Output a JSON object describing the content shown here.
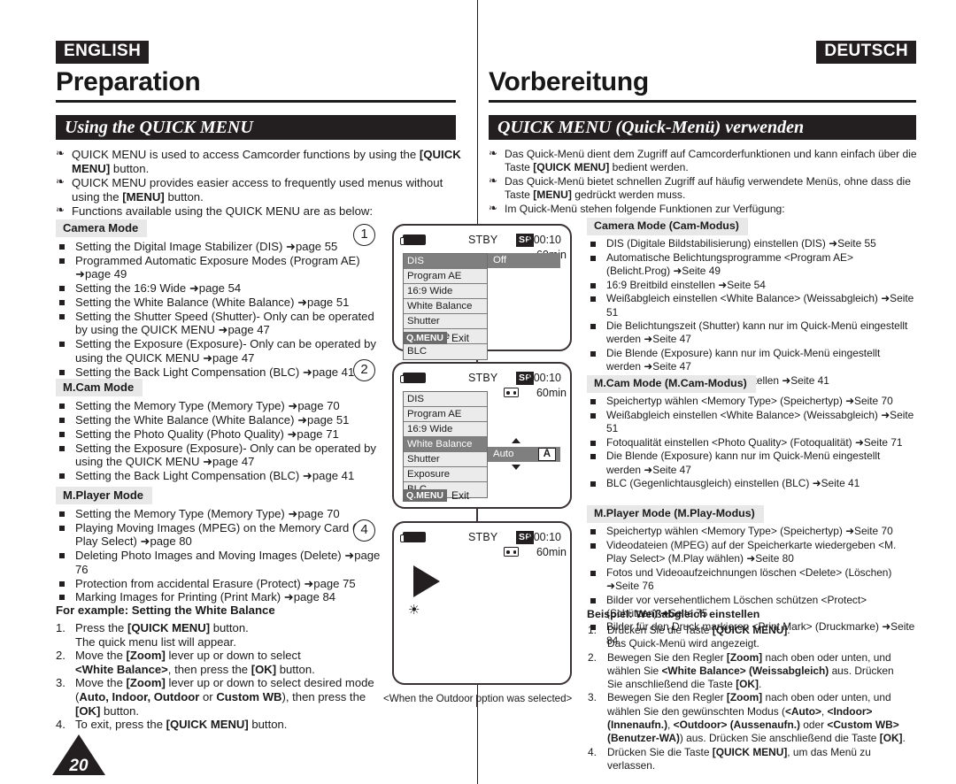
{
  "page_number": "20",
  "english": {
    "lang_tag": "ENGLISH",
    "chapter": "Preparation",
    "banner": "Using the QUICK MENU",
    "intro": [
      "QUICK MENU is used to access Camcorder functions by using the [QUICK MENU] button.",
      "QUICK MENU provides easier access to frequently used menus without using the [MENU] button.",
      "Functions available using the QUICK MENU are as below:"
    ],
    "sections": [
      {
        "heading": "Camera Mode",
        "items": [
          "Setting the Digital Image Stabilizer (DIS) ➜page 55",
          "Programmed Automatic Exposure Modes (Program AE) ➜page 49",
          "Setting the 16:9 Wide ➜page 54",
          "Setting the White Balance (White Balance) ➜page 51",
          "Setting the Shutter Speed (Shutter)- Only can be operated by using the QUICK MENU ➜page 47",
          "Setting the Exposure (Exposure)- Only can be operated by using the QUICK MENU ➜page 47",
          "Setting the Back Light Compensation (BLC) ➜page 41"
        ]
      },
      {
        "heading": "M.Cam Mode",
        "items": [
          "Setting the Memory Type (Memory Type) ➜page 70",
          "Setting the White Balance (White Balance) ➜page 51",
          "Setting the Photo Quality (Photo Quality) ➜page 71",
          "Setting the Exposure (Exposure)- Only can be operated by using the QUICK MENU ➜page 47",
          "Setting the Back Light Compensation (BLC) ➜page 41"
        ]
      },
      {
        "heading": "M.Player Mode",
        "items": [
          "Setting the Memory Type (Memory Type) ➜page 70",
          "Playing Moving Images (MPEG) on the Memory Card (M. Play Select) ➜page 80",
          "Deleting Photo Images and Moving Images (Delete) ➜page 76",
          "Protection from accidental Erasure (Protect) ➜page 75",
          "Marking Images for Printing (Print Mark) ➜page 84"
        ]
      }
    ],
    "example_title": "For example: Setting the White Balance",
    "steps": [
      {
        "num": "1.",
        "html": "Press the <b>[QUICK MENU]</b> button.<br>The quick menu list will appear."
      },
      {
        "num": "2.",
        "html": "Move the <b>[Zoom]</b> lever up or down to select<br><b>&lt;White Balance&gt;</b>, then press the <b>[OK]</b> button."
      },
      {
        "num": "3.",
        "html": "Move the <b>[Zoom]</b> lever up or down to select desired mode<br>(<b>Auto, Indoor, Outdoor</b> or <b>Custom WB</b>), then press the<br><b>[OK]</b> button."
      },
      {
        "num": "4.",
        "html": "To exit, press the <b>[QUICK MENU]</b> button."
      }
    ]
  },
  "german": {
    "lang_tag": "DEUTSCH",
    "chapter": "Vorbereitung",
    "banner": "QUICK MENU (Quick-Menü) verwenden",
    "intro": [
      "Das Quick-Menü dient dem Zugriff auf Camcorderfunktionen und kann einfach über die Taste [QUICK MENU] bedient werden.",
      "Das Quick-Menü bietet schnellen Zugriff auf häufig verwendete Menüs, ohne dass die Taste [MENU] gedrückt werden muss.",
      "Im Quick-Menü stehen folgende Funktionen zur Verfügung:"
    ],
    "sections": [
      {
        "heading": "Camera Mode (Cam-Modus)",
        "items": [
          "DIS (Digitale Bildstabilisierung) einstellen (DIS) ➜Seite 55",
          "Automatische Belichtungsprogramme &lt;Program AE&gt; (Belicht.Prog) ➜Seite 49",
          "16:9 Breitbild einstellen ➜Seite 54",
          "Weißabgleich einstellen &lt;White Balance&gt; (Weissabgleich) ➜Seite 51",
          "Die Belichtungszeit (Shutter) kann nur im Quick-Menü eingestellt werden ➜Seite 47",
          "Die Blende (Exposure) kann nur im Quick-Menü eingestellt werden ➜Seite 47",
          "BLC (Gegenlichtausgleich) einstellen ➜Seite 41"
        ]
      },
      {
        "heading": "M.Cam Mode (M.Cam-Modus)",
        "items": [
          "Speichertyp wählen &lt;Memory Type&gt; (Speichertyp) ➜Seite 70",
          "Weißabgleich einstellen &lt;White Balance&gt; (Weissabgleich) ➜Seite 51",
          "Fotoqualität einstellen &lt;Photo Quality&gt; (Fotoqualität) ➜Seite 71",
          "Die Blende (Exposure) kann nur im Quick-Menü eingestellt werden ➜Seite 47",
          "BLC (Gegenlichtausgleich) einstellen (BLC) ➜Seite 41"
        ]
      },
      {
        "heading": "M.Player Mode (M.Play-Modus)",
        "items": [
          "Speichertyp wählen &lt;Memory Type&gt; (Speichertyp) ➜Seite 70",
          "Videodateien (MPEG) auf der Speicherkarte wiedergeben &lt;M. Play Select&gt; (M.Play wählen) ➜Seite 80",
          "Fotos und Videoaufzeichnungen löschen &lt;Delete&gt; (Löschen) ➜Seite 76",
          "Bilder vor versehentlichem Löschen schützen &lt;Protect&gt; (Schützen) ➜Seite 75",
          "Bilder für den Druck markieren &lt;Print Mark&gt; (Druckmarke) ➜Seite 84"
        ]
      }
    ],
    "example_title": "Beispiel: Weißabgleich einstellen",
    "steps": [
      {
        "num": "1.",
        "html": "Drücken Sie die Taste <b>[QUICK MENU]</b>.<br>Das Quick-Menü wird angezeigt."
      },
      {
        "num": "2.",
        "html": "Bewegen Sie den Regler <b>[Zoom]</b> nach oben oder unten, und<br>wählen Sie <b>&lt;White Balance&gt; (Weissabgleich)</b> aus. Drücken<br>Sie anschließend die Taste <b>[OK]</b>."
      },
      {
        "num": "3.",
        "html": "Bewegen Sie den Regler <b>[Zoom]</b> nach oben oder unten, und<br>wählen Sie den gewünschten Modus (<b>&lt;Auto&gt;</b>, <b>&lt;Indoor&gt;</b><br><b>(Innenaufn.)</b>, <b>&lt;Outdoor&gt; (Aussenaufn.)</b> oder <b>&lt;Custom WB&gt;</b><br><b>(Benutzer-WA)</b>) aus. Drücken Sie anschließend die Taste <b>[OK]</b>."
      },
      {
        "num": "4.",
        "html": "Drücken Sie die Taste <b>[QUICK MENU]</b>, um das Menü zu verlassen."
      }
    ]
  },
  "lcd_screens": {
    "callouts": [
      "1",
      "2",
      "4"
    ],
    "status": {
      "stby": "STBY",
      "sp": "SP",
      "timecode": "0:00:10",
      "tape_minutes": "60min"
    },
    "menu_items": [
      "DIS",
      "Program AE",
      "16:9 Wide",
      "White Balance",
      "Shutter",
      "Exposure",
      "BLC"
    ],
    "exit_key": "Q.MENU",
    "exit_label": "Exit",
    "screen1": {
      "selected": "DIS",
      "value": "Off"
    },
    "screen2": {
      "selected": "White Balance",
      "value": "Auto",
      "value_chip": "A"
    },
    "screen3": {
      "icons": [
        "play-triangle",
        "outdoor-sun"
      ]
    },
    "caption": "<When the Outdoor option was selected>"
  }
}
